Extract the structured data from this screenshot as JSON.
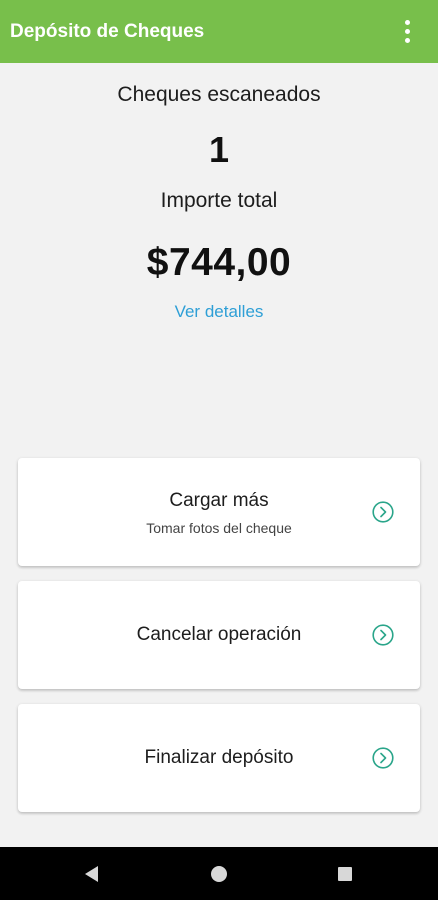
{
  "app_bar": {
    "title": "Depósito de Cheques",
    "menu_icon": "more-vert-icon",
    "background_color": "#78bf4b"
  },
  "summary": {
    "scanned_label": "Cheques escaneados",
    "scanned_count": "1",
    "total_label": "Importe total",
    "total_amount": "$744,00",
    "details_link": "Ver detalles",
    "link_color": "#2e9fd6"
  },
  "actions": [
    {
      "title": "Cargar más",
      "subtitle": "Tomar fotos del cheque",
      "icon": "chevron-circle-right-icon"
    },
    {
      "title": "Cancelar operación",
      "icon": "chevron-circle-right-icon"
    },
    {
      "title": "Finalizar depósito",
      "icon": "chevron-circle-right-icon"
    }
  ],
  "accent_color": "#2aa58a",
  "system_nav": {
    "back_icon": "back-triangle-icon",
    "home_icon": "home-circle-icon",
    "recents_icon": "recents-square-icon"
  }
}
